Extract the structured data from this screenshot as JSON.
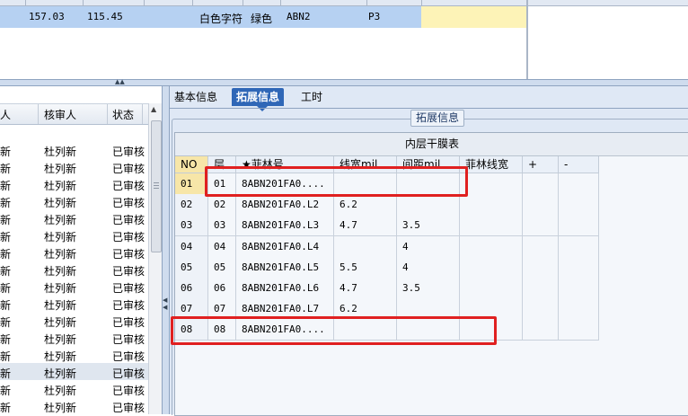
{
  "top_grid": {
    "row": [
      "157.03",
      "115.45",
      "白色字符",
      "绿色",
      "ABN2",
      "P3"
    ]
  },
  "left_grid": {
    "headers": [
      "人",
      "核审人",
      "状态"
    ],
    "rows": [
      [
        "新",
        "杜列新",
        "已审核"
      ],
      [
        "新",
        "杜列新",
        "已审核"
      ],
      [
        "新",
        "杜列新",
        "已审核"
      ],
      [
        "新",
        "杜列新",
        "已审核"
      ],
      [
        "新",
        "杜列新",
        "已审核"
      ],
      [
        "新",
        "杜列新",
        "已审核"
      ],
      [
        "新",
        "杜列新",
        "已审核"
      ],
      [
        "新",
        "杜列新",
        "已审核"
      ],
      [
        "新",
        "杜列新",
        "已审核"
      ],
      [
        "新",
        "杜列新",
        "已审核"
      ],
      [
        "新",
        "杜列新",
        "已审核"
      ],
      [
        "新",
        "杜列新",
        "已审核"
      ],
      [
        "新",
        "杜列新",
        "已审核"
      ],
      [
        "新",
        "杜列新",
        "已审核"
      ],
      [
        "新",
        "杜列新",
        "已审核"
      ],
      [
        "新",
        "杜列新",
        "已审核"
      ]
    ]
  },
  "tabs": [
    "基本信息",
    "拓展信息",
    "工时"
  ],
  "group_caption": "拓展信息",
  "inner_table": {
    "title": "内层干膜表",
    "headers": [
      "NO",
      "层",
      "★菲林号",
      "线宽mil",
      "间距mil",
      "菲林线宽",
      "+",
      "-"
    ],
    "rows": [
      [
        "01",
        "01",
        "8ABN201FA0....",
        "",
        "",
        "",
        "",
        ""
      ],
      [
        "02",
        "02",
        "8ABN201FA0.L2",
        "6.2",
        "",
        "",
        "",
        ""
      ],
      [
        "03",
        "03",
        "8ABN201FA0.L3",
        "4.7",
        "3.5",
        "",
        "",
        ""
      ],
      [
        "04",
        "04",
        "8ABN201FA0.L4",
        "",
        "4",
        "",
        "",
        ""
      ],
      [
        "05",
        "05",
        "8ABN201FA0.L5",
        "5.5",
        "4",
        "",
        "",
        ""
      ],
      [
        "06",
        "06",
        "8ABN201FA0.L6",
        "4.7",
        "3.5",
        "",
        "",
        ""
      ],
      [
        "07",
        "07",
        "8ABN201FA0.L7",
        "6.2",
        "",
        "",
        "",
        ""
      ],
      [
        "08",
        "08",
        "8ABN201FA0....",
        "",
        "",
        "",
        "",
        ""
      ]
    ]
  }
}
